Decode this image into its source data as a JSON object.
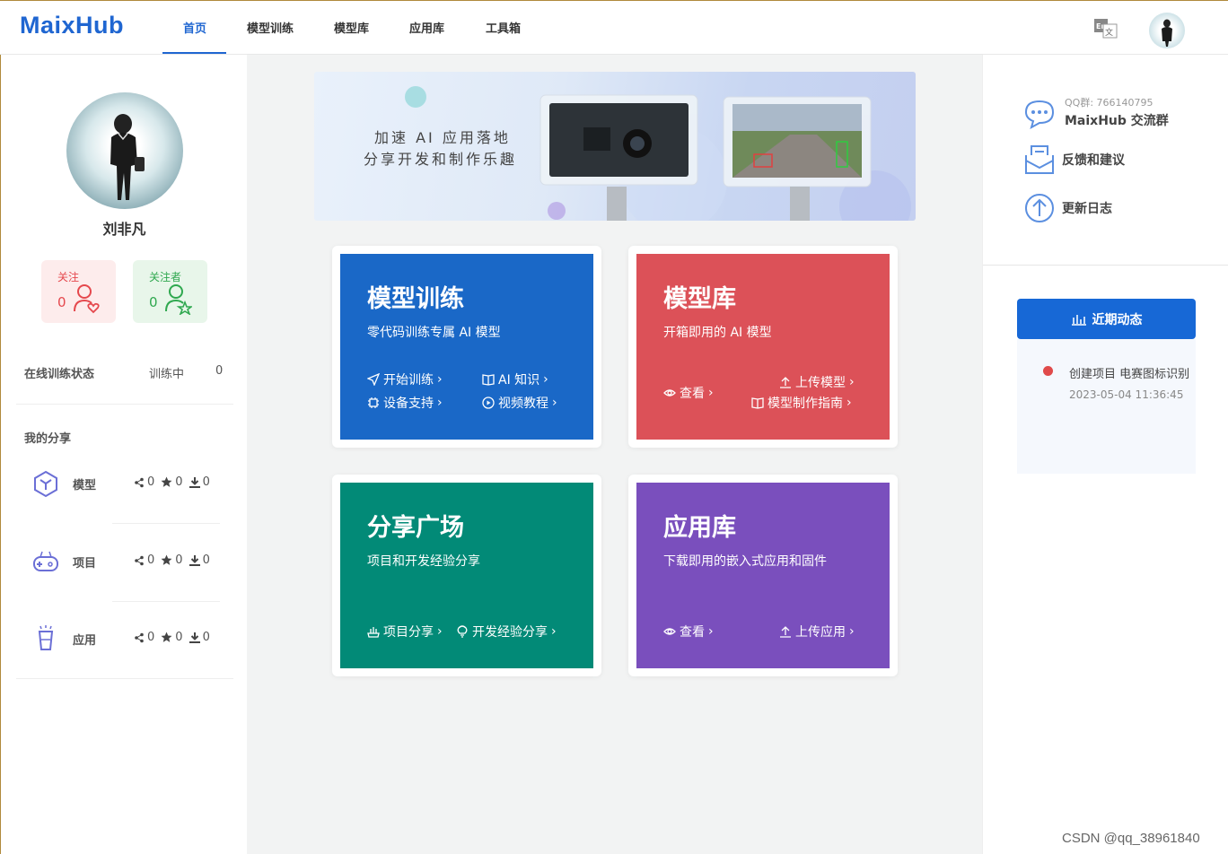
{
  "app": {
    "logo": "MaixHub"
  },
  "nav": {
    "items": [
      {
        "label": "首页",
        "active": true
      },
      {
        "label": "模型训练"
      },
      {
        "label": "模型库"
      },
      {
        "label": "应用库"
      },
      {
        "label": "工具箱"
      }
    ]
  },
  "user": {
    "name": "刘非凡",
    "follow_label": "关注",
    "follow_count": "0",
    "follower_label": "关注者",
    "follower_count": "0"
  },
  "training": {
    "label": "在线训练状态",
    "state": "训练中",
    "count": "0"
  },
  "shares": {
    "title": "我的分享",
    "rows": [
      {
        "name": "模型",
        "share": "0",
        "star": "0",
        "download": "0"
      },
      {
        "name": "项目",
        "share": "0",
        "star": "0",
        "download": "0"
      },
      {
        "name": "应用",
        "share": "0",
        "star": "0",
        "download": "0"
      }
    ]
  },
  "banner": {
    "line1": "加速 AI 应用落地",
    "line2": "分享开发和制作乐趣"
  },
  "cards": {
    "training": {
      "title": "模型训练",
      "subtitle": "零代码训练专属 AI 模型",
      "link1": "开始训练",
      "link2": "AI 知识",
      "link3": "设备支持",
      "link4": "视频教程",
      "color": "#1a68c7"
    },
    "library": {
      "title": "模型库",
      "subtitle": "开箱即用的 AI 模型",
      "link1": "查看",
      "link2": "上传模型",
      "link3": "模型制作指南",
      "color": "#dc5158"
    },
    "square": {
      "title": "分享广场",
      "subtitle": "项目和开发经验分享",
      "link1": "项目分享",
      "link2": "开发经验分享",
      "color": "#028a77"
    },
    "apps": {
      "title": "应用库",
      "subtitle": "下载即用的嵌入式应用和固件",
      "link1": "查看",
      "link2": "上传应用",
      "color": "#7a4fbd"
    }
  },
  "right": {
    "qq_small": "QQ群: 766140795",
    "qq_name": "MaixHub 交流群",
    "feedback": "反馈和建议",
    "changelog": "更新日志",
    "dynamics_btn": "近期动态",
    "dynamics": {
      "text": "创建项目 电赛图标识别",
      "time": "2023-05-04 11:36:45"
    }
  },
  "watermark": "CSDN @qq_38961840"
}
